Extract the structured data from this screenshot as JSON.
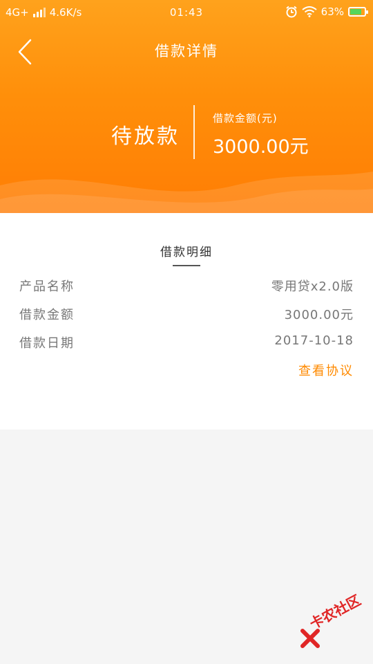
{
  "status_bar": {
    "network": "4G+",
    "speed": "4.6K/s",
    "time": "01:43",
    "battery": "63%"
  },
  "header": {
    "title": "借款详情"
  },
  "summary": {
    "status": "待放款",
    "amount_label": "借款金额(元)",
    "amount_value": "3000.00元"
  },
  "detail": {
    "title": "借款明细",
    "rows": [
      {
        "key": "产品名称",
        "value": "零用贷x2.0版"
      },
      {
        "key": "借款金额",
        "value": "3000.00元"
      },
      {
        "key": "借款日期",
        "value": "2017-10-18"
      }
    ],
    "agreement_link": "查看协议"
  },
  "watermark": {
    "text": "卡农社区"
  },
  "colors": {
    "accent": "#ff8a00",
    "header_top": "#ffa21c",
    "header_bottom": "#ff7d04"
  }
}
